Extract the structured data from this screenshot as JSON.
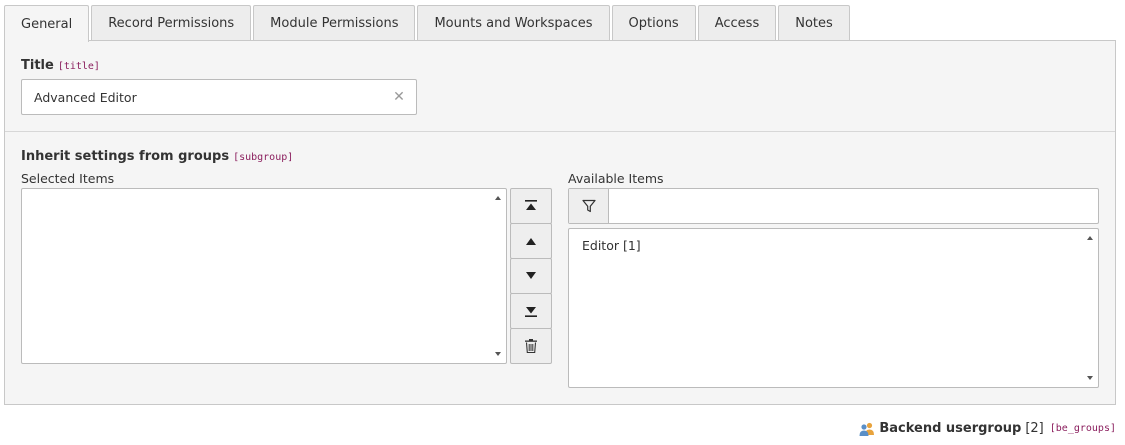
{
  "tabs": [
    {
      "label": "General",
      "active": true
    },
    {
      "label": "Record Permissions"
    },
    {
      "label": "Module Permissions"
    },
    {
      "label": "Mounts and Workspaces"
    },
    {
      "label": "Options"
    },
    {
      "label": "Access"
    },
    {
      "label": "Notes"
    }
  ],
  "title_field": {
    "label": "Title",
    "key": "[title]",
    "value": "Advanced Editor",
    "clear_icon": "close-icon"
  },
  "subgroup_field": {
    "label": "Inherit settings from groups",
    "key": "[subgroup]",
    "selected_label": "Selected Items",
    "available_label": "Available Items",
    "selected_items": [],
    "available_items": [
      "Editor [1]"
    ],
    "filter_value": "",
    "controls": [
      "move-top-icon",
      "move-up-icon",
      "move-down-icon",
      "move-bottom-icon",
      "delete-icon"
    ]
  },
  "footer": {
    "icon": "user-group-icon",
    "table_name": "Backend usergroup",
    "count": "[2]",
    "table_key": "[be_groups]"
  }
}
